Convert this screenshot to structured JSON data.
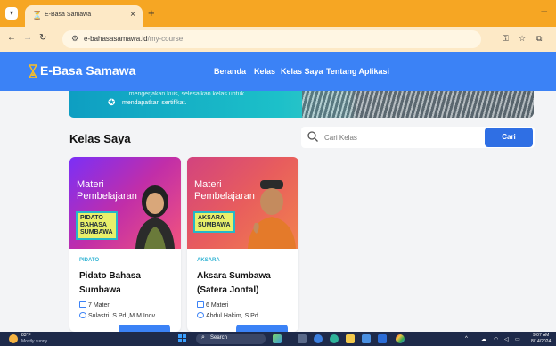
{
  "browser": {
    "tab_title": "E-Basa Samawa",
    "url_domain": "e-bahasasamawa.id",
    "url_path": "/my-course"
  },
  "site": {
    "brand": "E-Basa Samawa",
    "nav": [
      "Beranda",
      "Kelas",
      "Kelas Saya",
      "Tentang Aplikasi"
    ]
  },
  "banner": {
    "line1": "... mengerjakan kuis, selesaikan kelas untuk",
    "line2": "mendapatkan sertifikat."
  },
  "section": {
    "title": "Kelas Saya"
  },
  "search": {
    "placeholder": "Cari Kelas",
    "button_label": "Cari"
  },
  "courses": [
    {
      "thumb_line1": "Materi",
      "thumb_line2": "Pembelajaran",
      "thumb_badge": [
        "PIDATO",
        "BAHASA",
        "SUMBAWA"
      ],
      "category": "PIDATO",
      "title": "Pidato Bahasa Sumbawa",
      "materials": "7 Materi",
      "author": "Sulastri, S.Pd.,M.M.Inov."
    },
    {
      "thumb_line1": "Materi",
      "thumb_line2": "Pembelajaran",
      "thumb_badge": [
        "AKSARA",
        "SUMBAWA"
      ],
      "category": "AKSARA",
      "title": "Aksara Sumbawa (Satera Jontal)",
      "materials": "6 Materi",
      "author": "Abdul Hakim, S.Pd"
    }
  ],
  "taskbar": {
    "weather_temp": "83°F",
    "weather_desc": "Mostly sunny",
    "search_label": "Search",
    "time": "9:07 AM",
    "date": "8/14/2024"
  },
  "colors": {
    "brand_blue": "#3b82f6",
    "tab_orange": "#f6a623",
    "category_cyan": "#33b4d4"
  }
}
